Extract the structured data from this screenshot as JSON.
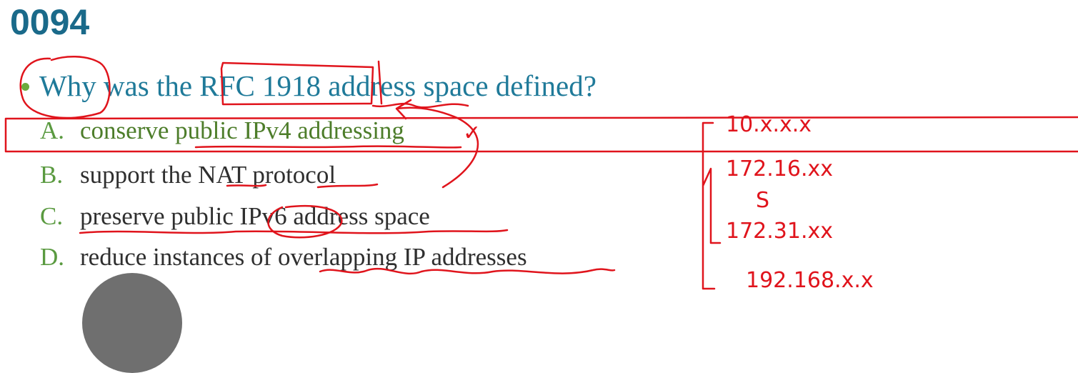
{
  "question": {
    "number": "0094",
    "text": "Why was the RFC 1918 address space defined?"
  },
  "options": [
    {
      "letter": "A.",
      "text": "conserve public IPv4 addressing"
    },
    {
      "letter": "B.",
      "text": "support the NAT protocol"
    },
    {
      "letter": "C.",
      "text": "preserve public IPv6 address space"
    },
    {
      "letter": "D.",
      "text": "reduce instances of overlapping IP addresses"
    }
  ],
  "annotations": {
    "check_mark": "✓",
    "private_ranges": [
      "10.x.x.x",
      "172.16.xx",
      "S",
      "172.31.xx",
      "192.168.x.x"
    ],
    "ink_color": "#e0141c"
  }
}
